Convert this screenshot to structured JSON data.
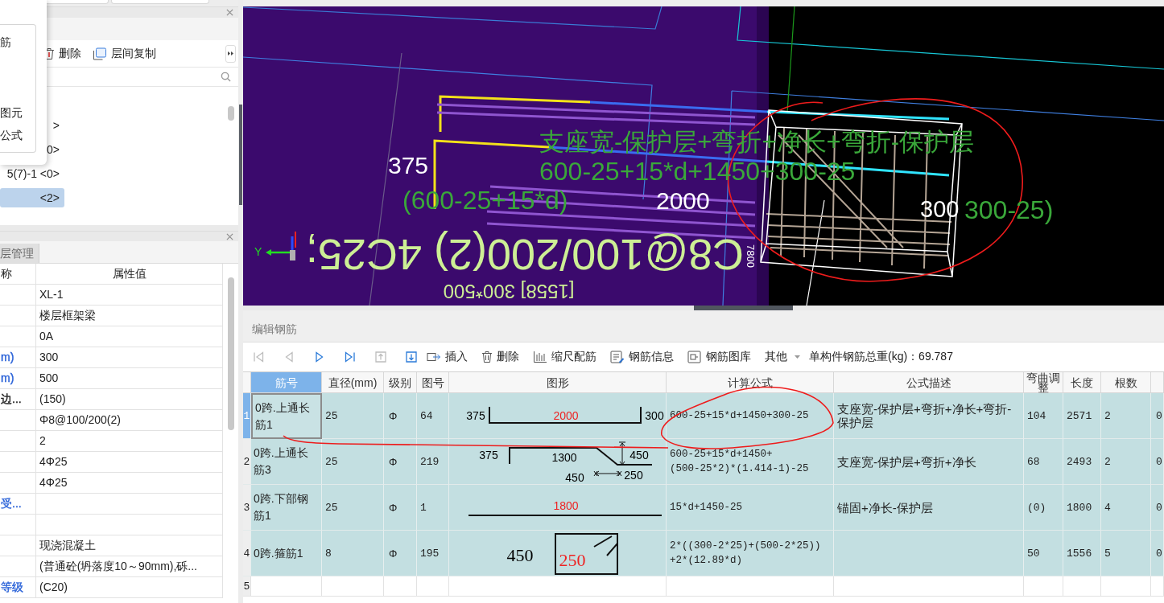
{
  "left_panel": {
    "context_menu": {
      "items": [
        {
          "label": "筋"
        },
        {
          "label": "图元"
        },
        {
          "label": "公式"
        }
      ]
    },
    "toolbar": {
      "buttons": [
        {
          "label": "删除",
          "kind": "delete"
        },
        {
          "label": "层间复制",
          "kind": "copy"
        }
      ]
    },
    "tree": {
      "items": [
        {
          "label": ">",
          "selected": false
        },
        {
          "label": "0>",
          "selected": false
        },
        {
          "label": "5(7)-1 <0>",
          "selected": false
        },
        {
          "label": "<2>",
          "selected": true
        }
      ]
    }
  },
  "properties": {
    "tab": "层管理",
    "columns": [
      "称",
      "属性值"
    ],
    "rows": [
      {
        "value": "XL-1"
      },
      {
        "value": "楼层框架梁"
      },
      {
        "value": "0A"
      },
      {
        "name": "m)",
        "color": "#2a62d8",
        "value": "300"
      },
      {
        "name": "m)",
        "color": "#2a62d8",
        "value": "500"
      },
      {
        "name": "边...",
        "color": "#222222",
        "value": "(150)"
      },
      {
        "value": "Φ8@100/200(2)"
      },
      {
        "value": "2"
      },
      {
        "value": "4Φ25"
      },
      {
        "value": "4Φ25"
      },
      {
        "name": "受...",
        "color": "#2a62d8"
      },
      {},
      {
        "value": "现浇混凝土"
      },
      {
        "value": "(普通砼(坍落度10～90mm),砾..."
      },
      {
        "name": "等级",
        "color": "#2a62d8",
        "value": "(C20)"
      }
    ]
  },
  "viewport": {
    "labels": [
      {
        "text": "支座宽-保护层+弯折+净长+弯折-保护层",
        "kind": "formula"
      },
      {
        "text": "600-25+15*d+1450+300-25",
        "kind": "formula"
      },
      {
        "text": "(600-25+15*d)",
        "kind": "formula"
      },
      {
        "text": "2000",
        "kind": "dimension"
      },
      {
        "text": "375",
        "kind": "dimension"
      },
      {
        "text": "300",
        "kind": "dimension"
      },
      {
        "text": "300-25)",
        "kind": "formula"
      },
      {
        "text": "C8@100/200(2) 4C25;",
        "kind": "note"
      },
      {
        "text": "[1558] 300*500",
        "kind": "note"
      },
      {
        "text": "7800",
        "kind": "dimension"
      },
      {
        "text": "Y",
        "kind": "axis"
      }
    ]
  },
  "rebar_editor": {
    "title": "编辑钢筋",
    "navigation": [
      {
        "kind": "first",
        "disabled": true
      },
      {
        "kind": "previous",
        "disabled": true
      },
      {
        "kind": "next",
        "disabled": false
      },
      {
        "kind": "last",
        "disabled": false
      },
      {
        "kind": "move-up",
        "disabled": true
      },
      {
        "kind": "move-down",
        "disabled": false
      }
    ],
    "actions": [
      {
        "label": "插入",
        "kind": "insert"
      },
      {
        "label": "删除",
        "kind": "delete"
      },
      {
        "label": "缩尺配筋",
        "kind": "scale"
      },
      {
        "label": "钢筋信息",
        "kind": "info"
      },
      {
        "label": "钢筋图库",
        "kind": "library"
      },
      {
        "label": "其他",
        "kind": "menu"
      }
    ],
    "total_weight": "单构件钢筋总重(kg)：69.787",
    "table": {
      "columns": [
        {
          "label": "筋号",
          "selected": true
        },
        {
          "label": "直径(mm)",
          "selected": false
        },
        {
          "label": "级别",
          "selected": false
        },
        {
          "label": "图号",
          "selected": false
        },
        {
          "label": "图形",
          "selected": false
        },
        {
          "label": "计算公式",
          "selected": false
        },
        {
          "label": "公式描述",
          "selected": false
        },
        {
          "label": "弯曲调整",
          "selected": false
        },
        {
          "label": "长度",
          "selected": false
        },
        {
          "label": "根数",
          "selected": false
        }
      ],
      "rows": [
        {
          "number": "1",
          "selected": true,
          "name": "0跨.上通长筋1",
          "diameter": "25",
          "grade": "Φ",
          "shape_no": "64",
          "shape": {
            "kind": "hooks",
            "labels": [
              {
                "text": "375",
                "color": "#000000"
              },
              {
                "text": "2000",
                "color": "#ee2222"
              },
              {
                "text": "300",
                "color": "#000000"
              }
            ]
          },
          "formula": "600-25+15*d+1450+300-25",
          "description": "支座宽-保护层+弯折+净长+弯折-保护层",
          "bend_adjust": "104",
          "length": "2571",
          "count": "2",
          "column_11": "0"
        },
        {
          "number": "2",
          "selected": false,
          "name": "0跨.上通长筋3",
          "diameter": "25",
          "grade": "Φ",
          "shape_no": "219",
          "shape": {
            "kind": "bent",
            "labels": [
              {
                "text": "375",
                "color": "#000000"
              },
              {
                "text": "1300",
                "color": "#000000"
              },
              {
                "text": "450",
                "color": "#000000"
              },
              {
                "text": "450",
                "color": "#000000"
              },
              {
                "text": "250",
                "color": "#000000"
              }
            ]
          },
          "formula": "600-25+15*d+1450+\n(500-25*2)*(1.414-1)-25",
          "description": "支座宽-保护层+弯折+净长",
          "bend_adjust": "68",
          "length": "2493",
          "count": "2",
          "column_11": "0"
        },
        {
          "number": "3",
          "selected": false,
          "name": "0跨.下部钢筋1",
          "diameter": "25",
          "grade": "Φ",
          "shape_no": "1",
          "shape": {
            "kind": "straight",
            "labels": [
              {
                "text": "1800",
                "color": "#ee2222"
              }
            ]
          },
          "formula": "15*d+1450-25",
          "description": "锚固+净长-保护层",
          "bend_adjust": "(0)",
          "length": "1800",
          "count": "4",
          "column_11": "0"
        },
        {
          "number": "4",
          "selected": false,
          "name": "0跨.箍筋1",
          "diameter": "8",
          "grade": "Φ",
          "shape_no": "195",
          "shape": {
            "kind": "stirrup",
            "labels": [
              {
                "text": "450",
                "color": "#000000"
              },
              {
                "text": "250",
                "color": "#ee2222"
              }
            ]
          },
          "formula": "2*((300-2*25)+(500-2*25))\n+2*(12.89*d)",
          "bend_adjust": "50",
          "length": "1556",
          "count": "5",
          "column_11": "0"
        },
        {
          "number": "5",
          "selected": false
        }
      ]
    }
  }
}
